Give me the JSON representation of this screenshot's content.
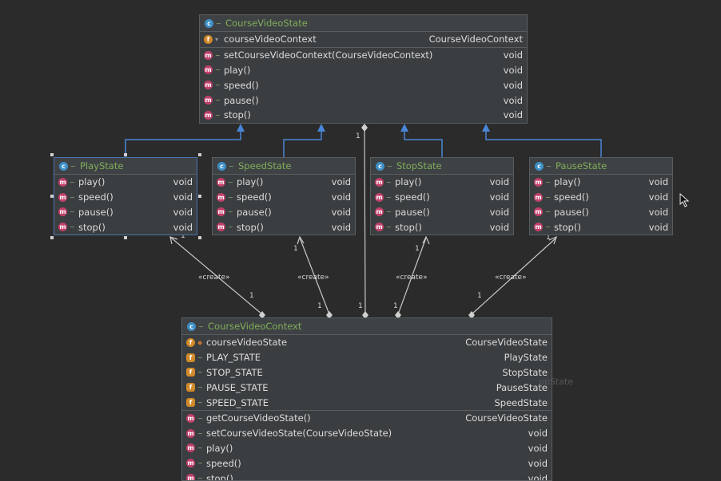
{
  "top_class": {
    "name": "CourseVideoState",
    "fields": [
      {
        "name": "courseVideoContext",
        "type": "CourseVideoContext",
        "icon": "field-icon"
      }
    ],
    "methods": [
      {
        "name": "setCourseVideoContext(CourseVideoContext)",
        "type": "void"
      },
      {
        "name": "play()",
        "type": "void"
      },
      {
        "name": "speed()",
        "type": "void"
      },
      {
        "name": "pause()",
        "type": "void"
      },
      {
        "name": "stop()",
        "type": "void"
      }
    ]
  },
  "state_classes": [
    {
      "name": "PlayState",
      "methods": [
        {
          "name": "play()",
          "type": "void"
        },
        {
          "name": "speed()",
          "type": "void"
        },
        {
          "name": "pause()",
          "type": "void"
        },
        {
          "name": "stop()",
          "type": "void"
        }
      ]
    },
    {
      "name": "SpeedState",
      "methods": [
        {
          "name": "play()",
          "type": "void"
        },
        {
          "name": "speed()",
          "type": "void"
        },
        {
          "name": "pause()",
          "type": "void"
        },
        {
          "name": "stop()",
          "type": "void"
        }
      ]
    },
    {
      "name": "StopState",
      "methods": [
        {
          "name": "play()",
          "type": "void"
        },
        {
          "name": "speed()",
          "type": "void"
        },
        {
          "name": "pause()",
          "type": "void"
        },
        {
          "name": "stop()",
          "type": "void"
        }
      ]
    },
    {
      "name": "PauseState",
      "methods": [
        {
          "name": "play()",
          "type": "void"
        },
        {
          "name": "speed()",
          "type": "void"
        },
        {
          "name": "pause()",
          "type": "void"
        },
        {
          "name": "stop()",
          "type": "void"
        }
      ]
    }
  ],
  "bottom_class": {
    "name": "CourseVideoContext",
    "fields": [
      {
        "name": "courseVideoState",
        "type": "CourseVideoState",
        "icon": "field-icon"
      },
      {
        "name": "PLAY_STATE",
        "type": "PlayState",
        "icon": "static-field-icon"
      },
      {
        "name": "STOP_STATE",
        "type": "StopState",
        "icon": "static-field-icon"
      },
      {
        "name": "PAUSE_STATE",
        "type": "PauseState",
        "icon": "static-field-icon"
      },
      {
        "name": "SPEED_STATE",
        "type": "SpeedState",
        "icon": "static-field-icon"
      }
    ],
    "methods": [
      {
        "name": "getCourseVideoState()",
        "type": "CourseVideoState"
      },
      {
        "name": "setCourseVideoState(CourseVideoState)",
        "type": "void"
      },
      {
        "name": "play()",
        "type": "void"
      },
      {
        "name": "speed()",
        "type": "void"
      },
      {
        "name": "stop()",
        "type": "void"
      }
    ]
  },
  "relations": {
    "create_label": "«create»",
    "multiplicity": "1"
  },
  "ghost_text": "ppState",
  "icons": {
    "class": "class-icon",
    "method": "method-icon",
    "field": "field-icon",
    "static_field": "static-field-icon"
  },
  "colors": {
    "background": "#2b2b2b",
    "class_name": "#7fae5a",
    "inherit_arrow": "#4a86d8",
    "selection": "#4a74b0"
  }
}
